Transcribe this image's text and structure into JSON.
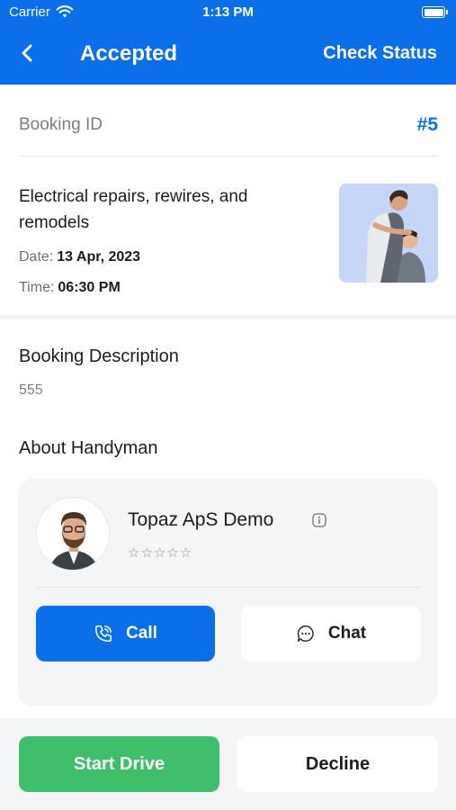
{
  "status_bar": {
    "carrier": "Carrier",
    "time": "1:13 PM"
  },
  "header": {
    "title": "Accepted",
    "action": "Check Status",
    "back_icon": "chevron-left-icon",
    "background": "#0a6fe8"
  },
  "booking": {
    "id_label": "Booking ID",
    "id_value": "#5",
    "service_name": "Electrical repairs, rewires, and remodels",
    "date_label": "Date:",
    "date_value": "13 Apr, 2023",
    "time_label": "Time:",
    "time_value": "06:30 PM"
  },
  "description": {
    "title": "Booking Description",
    "text": "555"
  },
  "handyman": {
    "section_title": "About Handyman",
    "name": "Topaz ApS Demo",
    "rating_stars": "☆☆☆☆☆",
    "rating": 0,
    "info_icon": "info-icon",
    "call_label": "Call",
    "chat_label": "Chat",
    "call_icon": "phone-icon",
    "chat_icon": "chat-bubble-icon"
  },
  "actions": {
    "start_label": "Start Drive",
    "decline_label": "Decline"
  },
  "colors": {
    "primary": "#0a6fe8",
    "success": "#40bf6a",
    "card_bg": "#f4f5f7"
  }
}
